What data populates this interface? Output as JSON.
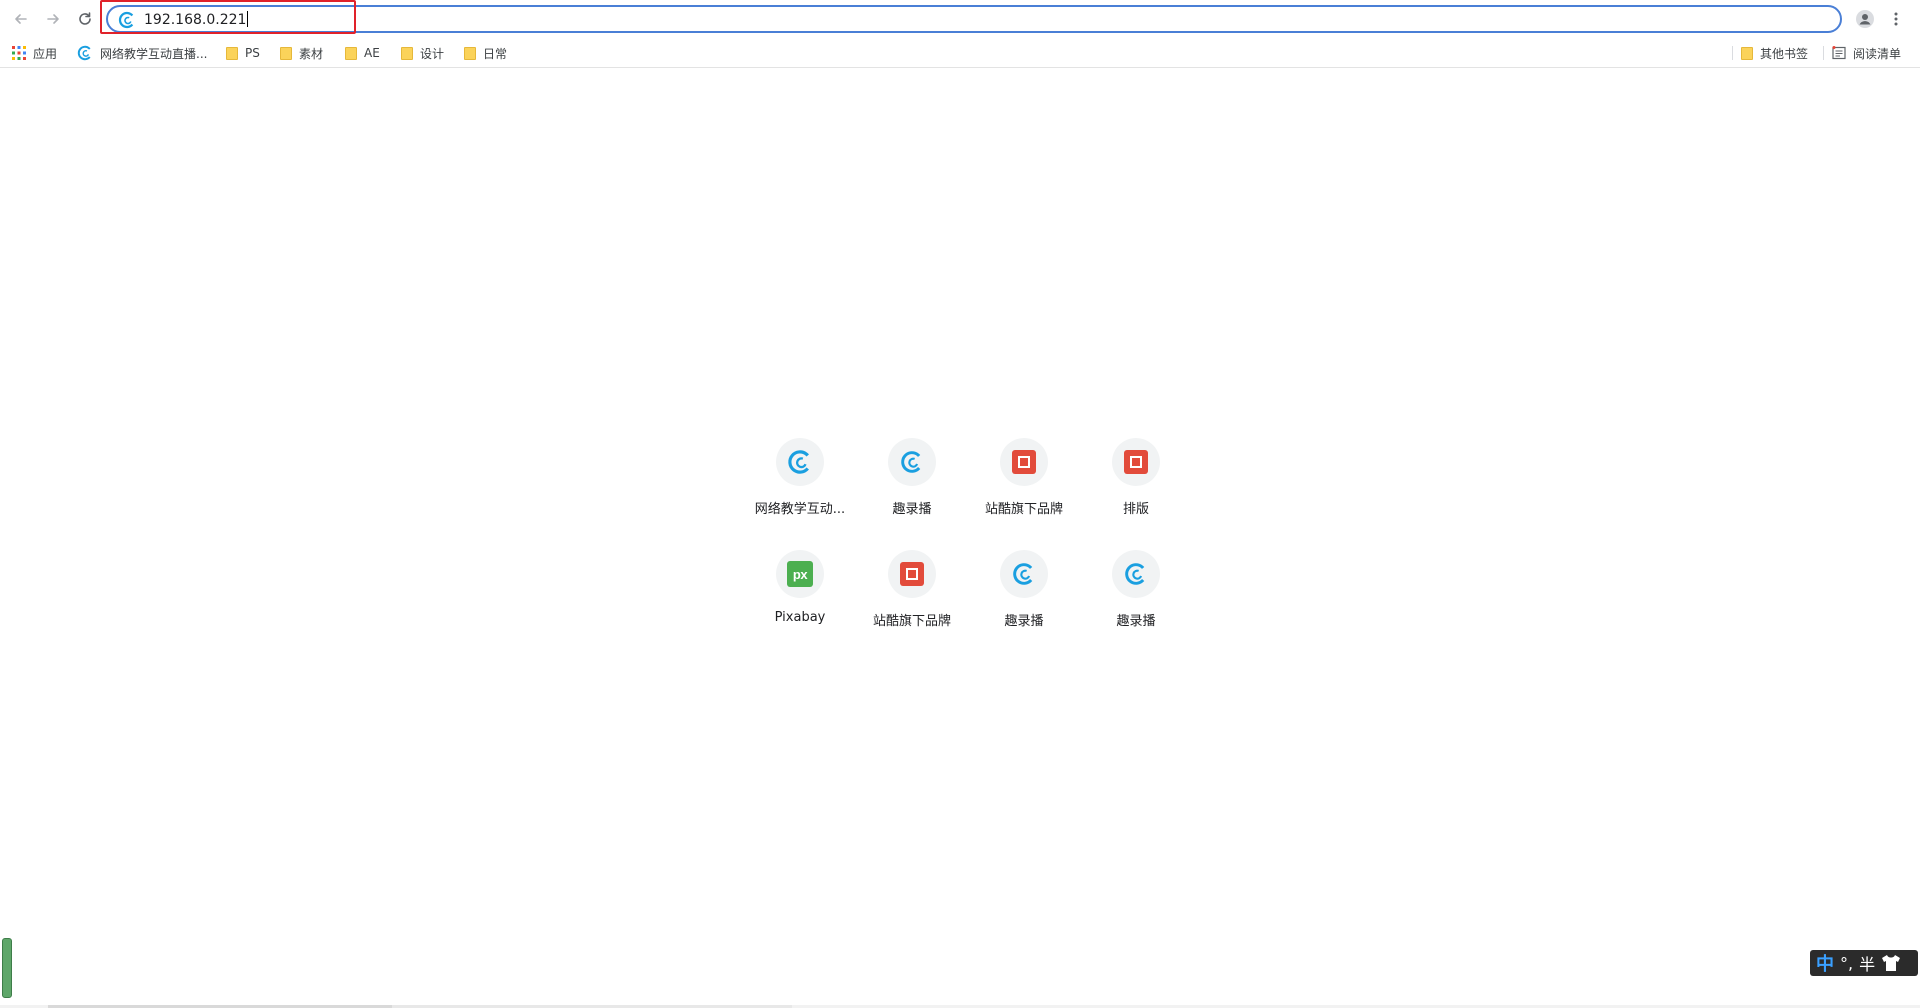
{
  "browser": {
    "url": "192.168.0.221",
    "back_icon": "arrow-left-icon",
    "forward_icon": "arrow-right-icon",
    "reload_icon": "reload-icon",
    "profile_icon": "person-icon",
    "menu_icon": "kebab-menu-icon",
    "accent_color": "#4a7fd6",
    "highlight_color": "#e0222a"
  },
  "bookmarks": {
    "apps_label": "应用",
    "items": [
      {
        "label": "网络教学互动直播...",
        "icon": "site-swirl-icon"
      },
      {
        "label": "PS",
        "icon": "folder-icon"
      },
      {
        "label": "素材",
        "icon": "folder-icon"
      },
      {
        "label": "AE",
        "icon": "folder-icon"
      },
      {
        "label": "设计",
        "icon": "folder-icon"
      },
      {
        "label": "日常",
        "icon": "folder-icon"
      }
    ],
    "other_label": "其他书签",
    "reading_list_label": "阅读清单"
  },
  "shortcuts": [
    {
      "label": "网络教学互动...",
      "icon": "swirl-icon"
    },
    {
      "label": "趣录播",
      "icon": "swirl-icon"
    },
    {
      "label": "站酷旗下品牌",
      "icon": "red-square-icon"
    },
    {
      "label": "排版",
      "icon": "red-square-icon"
    },
    {
      "label": "Pixabay",
      "icon": "pixabay-icon"
    },
    {
      "label": "站酷旗下品牌",
      "icon": "red-square-icon"
    },
    {
      "label": "趣录播",
      "icon": "swirl-icon"
    },
    {
      "label": "趣录播",
      "icon": "swirl-icon"
    }
  ],
  "pixabay_logo_text": "px",
  "ime": {
    "mode": "中",
    "punct": "°,",
    "width": "半",
    "skin_icon": "shirt-icon"
  }
}
